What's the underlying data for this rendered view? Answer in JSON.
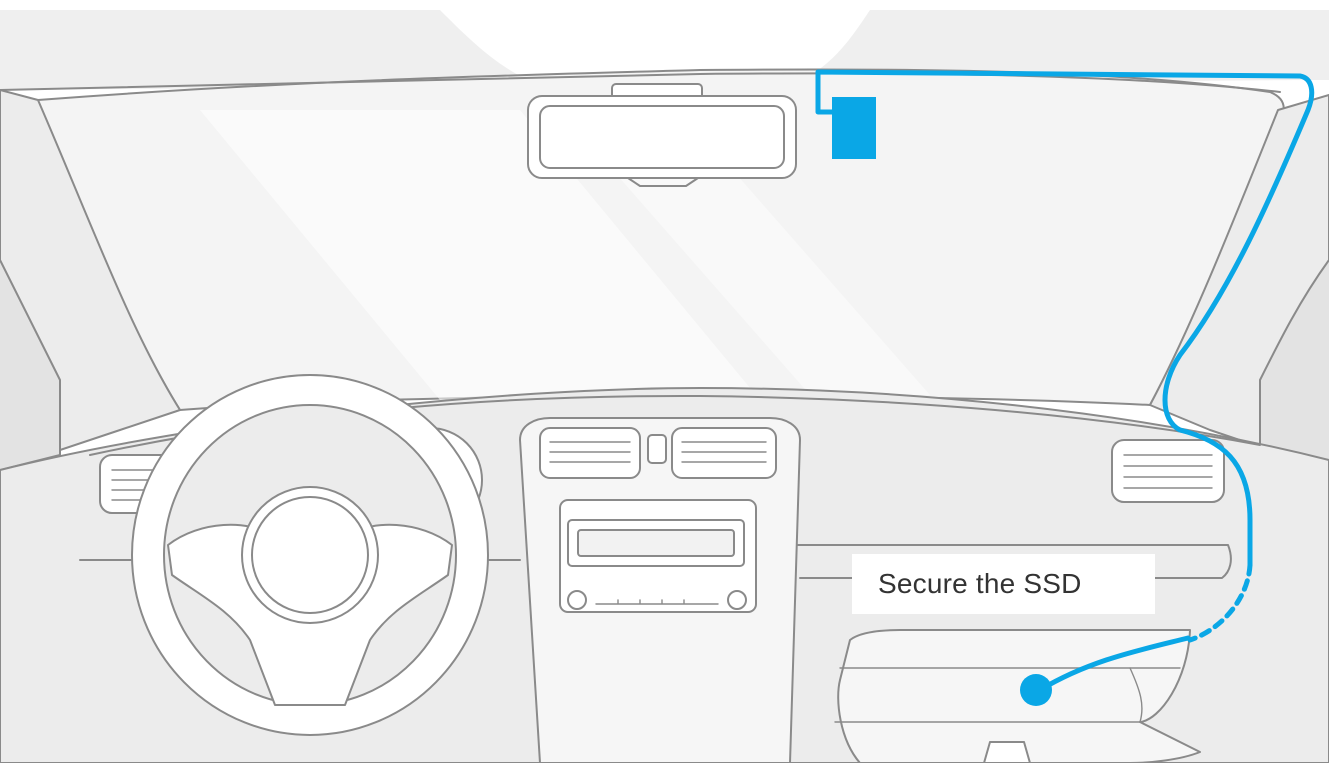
{
  "callout": {
    "text": "Secure the SSD"
  },
  "colors": {
    "cable": "#0aa7e6",
    "outline": "#8a8a8a",
    "interior": "#ececec",
    "glass": "#f5f5f5"
  },
  "icons": [
    "dash-camera-icon",
    "ssd-mount-point-icon",
    "steering-wheel-icon",
    "rear-view-mirror-icon"
  ]
}
